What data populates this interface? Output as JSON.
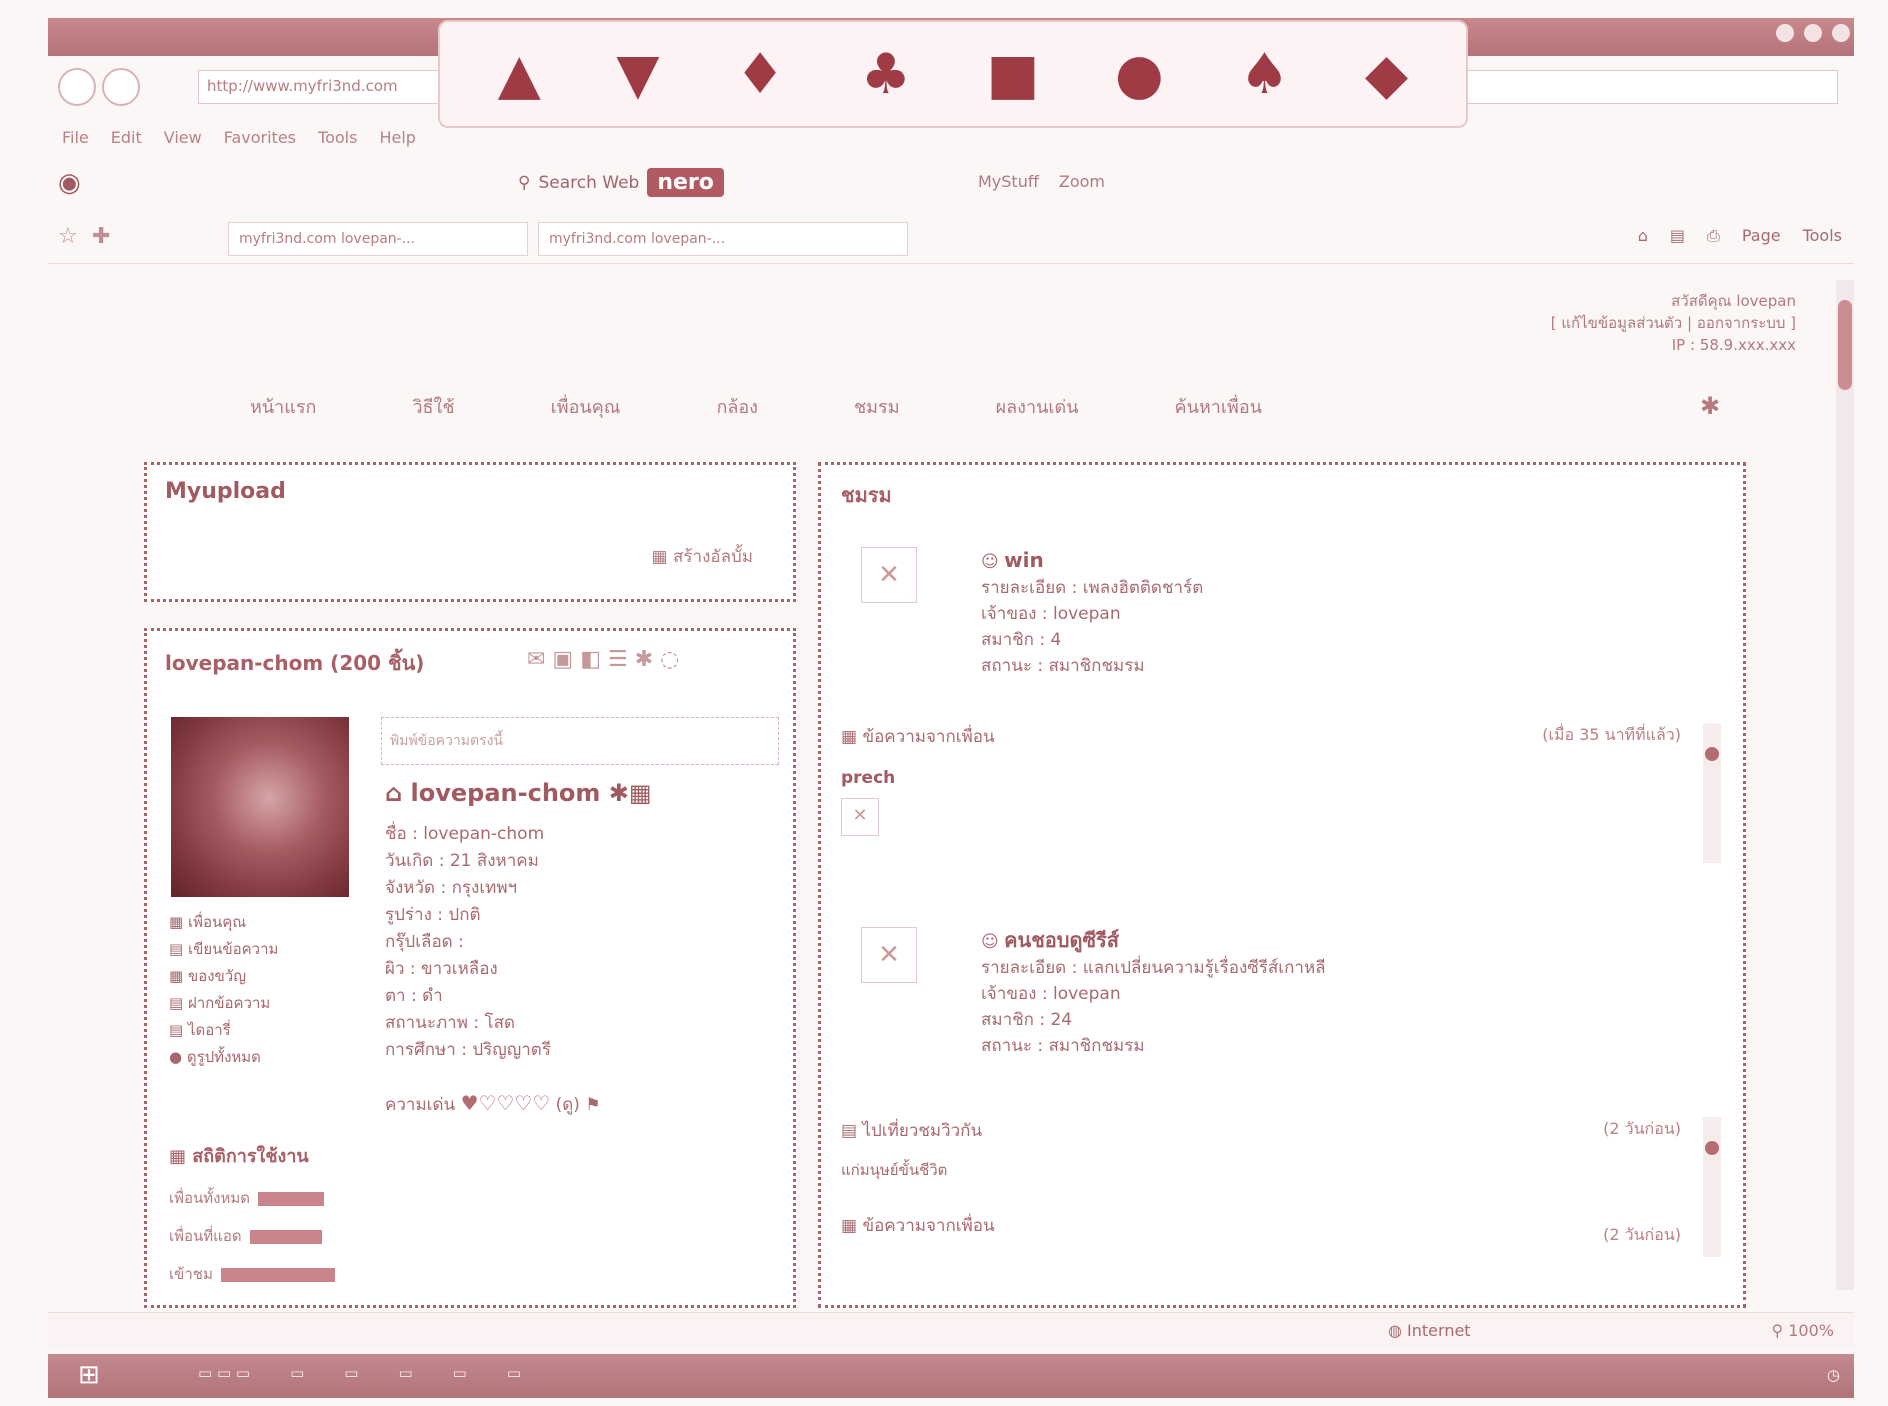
{
  "browser": {
    "address": "http://www.myfri3nd.com",
    "menu": [
      "File",
      "Edit",
      "View",
      "Favorites",
      "Tools",
      "Help"
    ],
    "search_label": "Search Web",
    "nero_label": "nero",
    "mystuff_label": "MyStuff",
    "zoom_label": "Zoom",
    "tabs": [
      "myfri3nd.com lovepan-...",
      "myfri3nd.com lovepan-..."
    ],
    "page_tool": "Page",
    "tools_tool": "Tools",
    "status_internet": "Internet",
    "status_zoom": "100%"
  },
  "banner_icons": [
    "bag-icon",
    "hat-icon",
    "dress-icon",
    "lantern-icon",
    "cake-icon",
    "e-icon",
    "shirt-icon",
    "fruit-icon"
  ],
  "user": {
    "greeting": "สวัสดีคุณ lovepan",
    "links": "[ แก้ไขข้อมูลส่วนตัว | ออกจากระบบ ]",
    "ip": "IP : 58.9.xxx.xxx"
  },
  "nav": [
    "หน้าแรก",
    "วิธีใช้",
    "เพื่อนคุณ",
    "กล้อง",
    "ชมรม",
    "ผลงานเด่น",
    "ค้นหาเพื่อน"
  ],
  "myupload": {
    "title": "Myupload",
    "create": "สร้างอัลบั้ม"
  },
  "profile": {
    "header": "lovepan-chom (200 ชิ้น)",
    "status_placeholder": "พิมพ์ข้อความตรงนี้",
    "username": "lovepan-chom",
    "details": [
      "ชื่อ : lovepan-chom",
      "วันเกิด : 21 สิงหาคม",
      "จังหวัด : กรุงเทพฯ",
      "รูปร่าง : ปกติ",
      "กรุ๊ปเลือด :",
      "ผิว : ขาวเหลือง",
      "ตา : ดำ",
      "สถานะภาพ : โสด",
      "การศึกษา : ปริญญาตรี"
    ],
    "hearts_label": "ความเด่น",
    "hearts_text": "(ดู)",
    "side_links": [
      "เพื่อนคุณ",
      "เขียนข้อความ",
      "ของขวัญ",
      "ฝากข้อความ",
      "ไดอารี่",
      "ดูรูปทั้งหมด"
    ],
    "stats_title": "สถิติการใช้งาน",
    "stats": [
      {
        "label": "เพื่อนทั้งหมด",
        "value": 0.55
      },
      {
        "label": "เพื่อนที่แอด",
        "value": 0.6
      },
      {
        "label": "เข้าชม",
        "value": 0.95
      }
    ]
  },
  "clubs": {
    "title": "ชมรม",
    "items": [
      {
        "name": "win",
        "lines": [
          "รายละเอียด : เพลงฮิตติดชาร์ต",
          "เจ้าของ : lovepan",
          "สมาชิก : 4",
          "สถานะ : สมาชิกชมรม"
        ]
      },
      {
        "name": "คนชอบดูซีรีส์",
        "lines": [
          "รายละเอียด : แลกเปลี่ยนความรู้เรื่องซีรีส์เกาหลี",
          "เจ้าของ : lovepan",
          "สมาชิก : 24",
          "สถานะ : สมาชิกชมรม"
        ]
      }
    ],
    "posts": [
      {
        "title": "ข้อความจากเพื่อน",
        "time": "(เมื่อ 35 นาทีที่แล้ว)",
        "body": "prech"
      },
      {
        "title": "ไปเที่ยวชมวิวกัน",
        "time": "(2 วันก่อน)",
        "body": "แก่มนุษย์ขั้นชีวิต"
      },
      {
        "title": "ข้อความจากเพื่อน",
        "time": "(2 วันก่อน)",
        "body": ""
      }
    ]
  }
}
